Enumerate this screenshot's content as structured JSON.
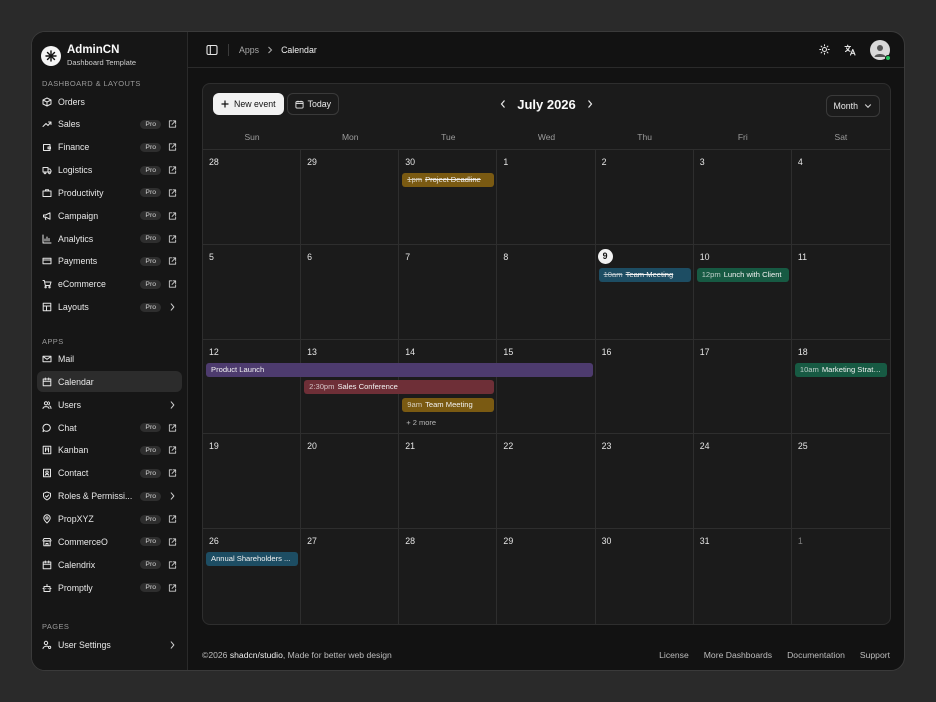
{
  "brand": {
    "name": "AdminCN",
    "subtitle": "Dashboard Template"
  },
  "sidebar": {
    "sections": [
      {
        "label": "Dashboard & Layouts",
        "items": [
          {
            "label": "Orders",
            "icon": "box-icon",
            "pro": "",
            "trail": ""
          },
          {
            "label": "Sales",
            "icon": "trending-up-icon",
            "pro": "Pro",
            "trail": "external-link-icon"
          },
          {
            "label": "Finance",
            "icon": "wallet-icon",
            "pro": "Pro",
            "trail": "external-link-icon"
          },
          {
            "label": "Logistics",
            "icon": "truck-icon",
            "pro": "Pro",
            "trail": "external-link-icon"
          },
          {
            "label": "Productivity",
            "icon": "briefcase-icon",
            "pro": "Pro",
            "trail": "external-link-icon"
          },
          {
            "label": "Campaign",
            "icon": "megaphone-icon",
            "pro": "Pro",
            "trail": "external-link-icon"
          },
          {
            "label": "Analytics",
            "icon": "bar-chart-icon",
            "pro": "Pro",
            "trail": "external-link-icon"
          },
          {
            "label": "Payments",
            "icon": "credit-card-icon",
            "pro": "Pro",
            "trail": "external-link-icon"
          },
          {
            "label": "eCommerce",
            "icon": "cart-icon",
            "pro": "Pro",
            "trail": "external-link-icon"
          },
          {
            "label": "Layouts",
            "icon": "layout-icon",
            "pro": "Pro",
            "trail": "chevron-right-icon"
          }
        ]
      },
      {
        "label": "Apps",
        "items": [
          {
            "label": "Mail",
            "icon": "mail-icon",
            "pro": "",
            "trail": ""
          },
          {
            "label": "Calendar",
            "icon": "calendar-icon",
            "pro": "",
            "trail": "",
            "active": true
          },
          {
            "label": "Users",
            "icon": "users-icon",
            "pro": "",
            "trail": "chevron-right-icon"
          },
          {
            "label": "Chat",
            "icon": "chat-icon",
            "pro": "Pro",
            "trail": "external-link-icon"
          },
          {
            "label": "Kanban",
            "icon": "kanban-icon",
            "pro": "Pro",
            "trail": "external-link-icon"
          },
          {
            "label": "Contact",
            "icon": "contact-icon",
            "pro": "Pro",
            "trail": "external-link-icon"
          },
          {
            "label": "Roles & Permissi...",
            "icon": "shield-icon",
            "pro": "Pro",
            "trail": "chevron-right-icon"
          },
          {
            "label": "PropXYZ",
            "icon": "map-pin-icon",
            "pro": "Pro",
            "trail": "external-link-icon"
          },
          {
            "label": "CommerceO",
            "icon": "store-icon",
            "pro": "Pro",
            "trail": "external-link-icon"
          },
          {
            "label": "Calendrix",
            "icon": "calendar-icon",
            "pro": "Pro",
            "trail": "external-link-icon"
          },
          {
            "label": "Promptly",
            "icon": "bot-icon",
            "pro": "Pro",
            "trail": "external-link-icon"
          }
        ]
      },
      {
        "label": "Pages",
        "items": [
          {
            "label": "User Settings",
            "icon": "user-cog-icon",
            "pro": "",
            "trail": "chevron-right-icon"
          }
        ]
      }
    ]
  },
  "topbar": {
    "breadcrumb": [
      "Apps",
      "Calendar"
    ],
    "icons": [
      "sidebar-toggle-icon",
      "sun-icon",
      "translate-icon",
      "avatar"
    ]
  },
  "calendar": {
    "new_event_label": "New event",
    "today_label": "Today",
    "month_title": "July 2026",
    "view_label": "Month",
    "weekdays": [
      "Sun",
      "Mon",
      "Tue",
      "Wed",
      "Thu",
      "Fri",
      "Sat"
    ],
    "weeks": [
      [
        {
          "d": "28",
          "muted": false
        },
        {
          "d": "29",
          "muted": false
        },
        {
          "d": "30",
          "muted": false
        },
        {
          "d": "1",
          "muted": false
        },
        {
          "d": "2",
          "muted": false
        },
        {
          "d": "3",
          "muted": false
        },
        {
          "d": "4",
          "muted": false
        }
      ],
      [
        {
          "d": "5",
          "muted": false
        },
        {
          "d": "6",
          "muted": false
        },
        {
          "d": "7",
          "muted": false
        },
        {
          "d": "8",
          "muted": false
        },
        {
          "d": "9",
          "today": true
        },
        {
          "d": "10",
          "muted": false
        },
        {
          "d": "11",
          "muted": false
        }
      ],
      [
        {
          "d": "12",
          "muted": false
        },
        {
          "d": "13",
          "muted": false
        },
        {
          "d": "14",
          "muted": false
        },
        {
          "d": "15",
          "muted": false
        },
        {
          "d": "16",
          "muted": false
        },
        {
          "d": "17",
          "muted": false
        },
        {
          "d": "18",
          "muted": false
        }
      ],
      [
        {
          "d": "19",
          "muted": false
        },
        {
          "d": "20",
          "muted": false
        },
        {
          "d": "21",
          "muted": false
        },
        {
          "d": "22",
          "muted": false
        },
        {
          "d": "23",
          "muted": false
        },
        {
          "d": "24",
          "muted": false
        },
        {
          "d": "25",
          "muted": false
        }
      ],
      [
        {
          "d": "26",
          "muted": false
        },
        {
          "d": "27",
          "muted": false
        },
        {
          "d": "28",
          "muted": false
        },
        {
          "d": "29",
          "muted": false
        },
        {
          "d": "30",
          "muted": false
        },
        {
          "d": "31",
          "muted": false
        },
        {
          "d": "1",
          "muted": true
        }
      ]
    ],
    "events": [
      {
        "week": 0,
        "start": 2,
        "span": 1,
        "row": 0,
        "time": "1pm",
        "label": "Project Deadline",
        "color": "#7a5a12",
        "strike": true
      },
      {
        "week": 1,
        "start": 4,
        "span": 1,
        "row": 0,
        "time": "10am",
        "label": "Team Meeting",
        "color": "#1d4d63",
        "strike": true
      },
      {
        "week": 1,
        "start": 5,
        "span": 1,
        "row": 0,
        "time": "12pm",
        "label": "Lunch with Client",
        "color": "#175a43",
        "strike": false
      },
      {
        "week": 2,
        "start": 0,
        "span": 4,
        "row": 0,
        "time": "",
        "label": "Product Launch",
        "color": "#4d3b6e",
        "strike": false
      },
      {
        "week": 2,
        "start": 6,
        "span": 1,
        "row": 0,
        "time": "10am",
        "label": "Marketing Strate...",
        "color": "#175a43",
        "strike": false
      },
      {
        "week": 2,
        "start": 1,
        "span": 2,
        "row": 1,
        "time": "2:30pm",
        "label": "Sales Conference",
        "color": "#6e2f37",
        "strike": false
      },
      {
        "week": 2,
        "start": 2,
        "span": 1,
        "row": 2,
        "time": "9am",
        "label": "Team Meeting",
        "color": "#7a5a12",
        "strike": false
      },
      {
        "week": 4,
        "start": 0,
        "span": 1,
        "row": 0,
        "time": "",
        "label": "Annual Shareholders ...",
        "color": "#1d4d63",
        "strike": false
      }
    ],
    "more": [
      {
        "week": 2,
        "col": 2,
        "row": 3,
        "label": "+ 2 more"
      }
    ]
  },
  "footer": {
    "prefix": "©2026 ",
    "brand": "shadcn/studio",
    "suffix": ", Made for better web design",
    "links": [
      "License",
      "More Dashboards",
      "Documentation",
      "Support"
    ]
  }
}
